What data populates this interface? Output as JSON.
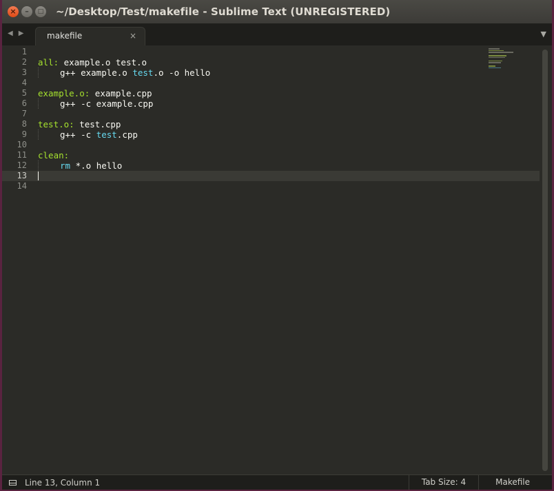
{
  "window": {
    "title": "~/Desktop/Test/makefile - Sublime Text (UNREGISTERED)",
    "close_glyph": "×",
    "minimize_glyph": "–",
    "maximize_glyph": "□"
  },
  "tabs": {
    "back_glyph": "◀",
    "forward_glyph": "▶",
    "active": {
      "label": "makefile",
      "close_glyph": "×"
    },
    "dropdown_glyph": "▼"
  },
  "editor": {
    "line_numbers": [
      "1",
      "2",
      "3",
      "4",
      "5",
      "6",
      "7",
      "8",
      "9",
      "10",
      "11",
      "12",
      "13",
      "14"
    ],
    "current_line": 13,
    "lines": {
      "l2": {
        "target": "all:",
        "deps": " example.o test.o"
      },
      "l3": {
        "a": "g++ example.o ",
        "b": "test",
        "c": ".o -o hello"
      },
      "l5": {
        "target": "example.o:",
        "deps": " example.cpp"
      },
      "l6": {
        "a": "g++ -c example.cpp"
      },
      "l8": {
        "target": "test.o:",
        "deps": " test.cpp"
      },
      "l9": {
        "a": "g++ -c ",
        "b": "test",
        "c": ".cpp"
      },
      "l11": {
        "target": "clean:"
      },
      "l12": {
        "cmd": "rm",
        "rest": " *.o hello"
      }
    },
    "colors": {
      "background": "#2b2b27",
      "target": "#a6e22e",
      "command": "#66d9ef",
      "text": "#f8f8f2"
    }
  },
  "status": {
    "position": "Line 13, Column 1",
    "tab_size": "Tab Size: 4",
    "syntax": "Makefile"
  }
}
